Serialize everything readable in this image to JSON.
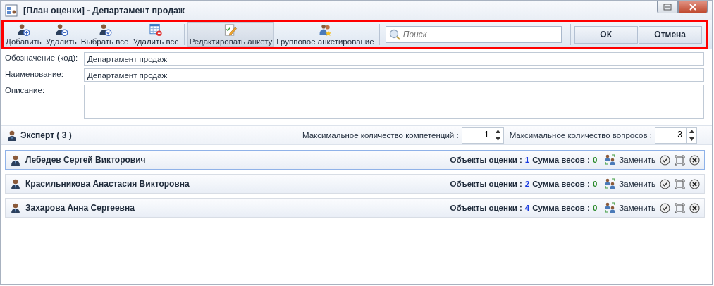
{
  "window": {
    "title": "[План оценки] - Департамент продаж"
  },
  "toolbar": {
    "buttons": [
      {
        "kind": "add",
        "label": "Добавить",
        "selected": false
      },
      {
        "kind": "remove",
        "label": "Удалить",
        "selected": false
      },
      {
        "kind": "select-all",
        "label": "Выбрать все",
        "selected": false
      },
      {
        "kind": "delete-all",
        "label": "Удалить все",
        "selected": false
      },
      {
        "kind": "edit",
        "label": "Редактировать анкету",
        "selected": true
      },
      {
        "kind": "group",
        "label": "Групповое анкетирование",
        "selected": false
      }
    ],
    "search": {
      "placeholder": "Поиск"
    },
    "actions": [
      "ОК",
      "Отмена"
    ]
  },
  "form": {
    "fields": [
      {
        "kind": "line",
        "label": "Обозначение (код):",
        "value": "Департамент продаж"
      },
      {
        "kind": "line",
        "label": "Наименование:",
        "value": "Департамент продаж"
      },
      {
        "kind": "area",
        "label": "Описание:"
      }
    ]
  },
  "experts": {
    "title": "Эксперт ( 3 )",
    "max_competencies_label": "Максимальное количество компетенций :",
    "max_competencies": "1",
    "max_questions_label": "Максимальное количество вопросов :",
    "max_questions": "3",
    "rows": [
      {
        "name": "Лебедев Сергей Викторович",
        "objects_label": "Объекты оценки :",
        "objects": "1",
        "weights_label": "Сумма весов :",
        "weights": "0",
        "replace": "Заменить",
        "selected": true
      },
      {
        "name": "Красильникова Анастасия Викторовна",
        "objects_label": "Объекты оценки :",
        "objects": "2",
        "weights_label": "Сумма весов :",
        "weights": "0",
        "replace": "Заменить",
        "selected": false
      },
      {
        "name": "Захарова Анна Сергеевна",
        "objects_label": "Объекты оценки :",
        "objects": "4",
        "weights_label": "Сумма весов :",
        "weights": "0",
        "replace": "Заменить",
        "selected": false
      }
    ]
  }
}
